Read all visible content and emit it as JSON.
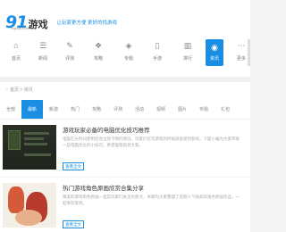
{
  "top_strip": {
    "text": ""
  },
  "brand": {
    "number": "91",
    "name": "游戏",
    "sub": "91youxi.com",
    "slogan": "让玩家更方便 更好的找游戏"
  },
  "categories": [
    {
      "label": "首页",
      "icon": "home-icon",
      "glyph": "⌂"
    },
    {
      "label": "新闻",
      "icon": "news-icon",
      "glyph": "☰"
    },
    {
      "label": "评测",
      "icon": "review-icon",
      "glyph": "✎"
    },
    {
      "label": "攻略",
      "icon": "guide-icon",
      "glyph": "❖"
    },
    {
      "label": "专题",
      "icon": "topic-icon",
      "glyph": "◈"
    },
    {
      "label": "手游",
      "icon": "mobile-icon",
      "glyph": "▯"
    },
    {
      "label": "排行",
      "icon": "rank-icon",
      "glyph": "▥"
    },
    {
      "label": "资讯",
      "icon": "info-icon",
      "glyph": "◉"
    },
    {
      "label": "更多",
      "icon": "more-icon",
      "glyph": "⋯"
    }
  ],
  "breadcrumb": {
    "home": "⌂",
    "path": "首页 > 资讯"
  },
  "tabs": [
    "全部",
    "最新",
    "新游",
    "热门",
    "攻略",
    "评测",
    "活动",
    "视频",
    "图片",
    "专题",
    "礼包"
  ],
  "active_tab_index": 1,
  "active_category_index": 7,
  "articles": [
    {
      "title": "游戏玩家必备的电脑优化技巧推荐",
      "summary": "电脑在长时间使用后会出现卡顿的情况，玩家们在玩游戏的时候就会受到影响，下面小编为大家带来一些电脑优化的小技巧，希望能帮助到大家。",
      "more": "查看全文"
    },
    {
      "title": "热门游戏角色原画欣赏合集分享",
      "summary": "精美的游戏角色原画一直是玩家们关注的焦点，本期为大家整理了近期人气很高的角色原画作品，一起来欣赏吧。",
      "more": "查看全文"
    }
  ],
  "colors": {
    "accent": "#1a8ee3"
  }
}
